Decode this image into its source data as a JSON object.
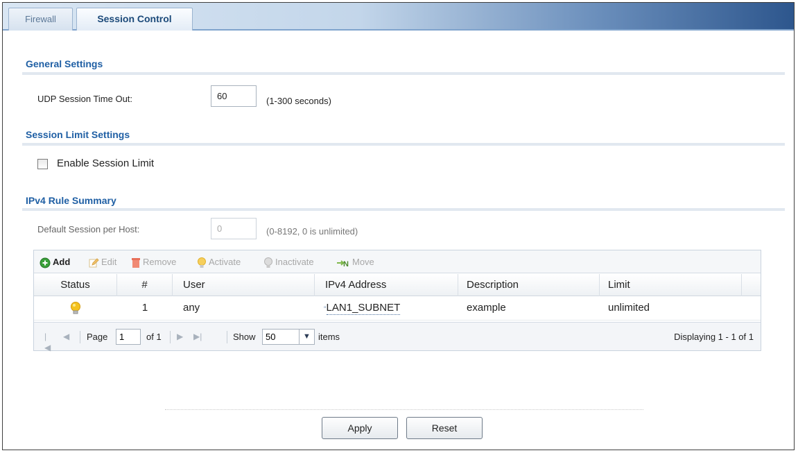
{
  "tabs": [
    {
      "label": "Firewall",
      "active": false
    },
    {
      "label": "Session Control",
      "active": true
    }
  ],
  "general": {
    "title": "General Settings",
    "udp_label": "UDP Session Time Out:",
    "udp_value": "60",
    "udp_hint": "(1-300 seconds)"
  },
  "session_limit": {
    "title": "Session Limit Settings",
    "enable_label": "Enable Session Limit",
    "enabled": false
  },
  "ipv4": {
    "title": "IPv4 Rule Summary",
    "default_label": "Default Session per Host:",
    "default_value": "0",
    "default_hint": "(0-8192, 0 is unlimited)"
  },
  "toolbar": {
    "add": "Add",
    "edit": "Edit",
    "remove": "Remove",
    "activate": "Activate",
    "inactivate": "Inactivate",
    "move": "Move"
  },
  "table": {
    "columns": [
      "Status",
      "#",
      "User",
      "IPv4 Address",
      "Description",
      "Limit"
    ],
    "rows": [
      {
        "status": "active",
        "num": "1",
        "user": "any",
        "ipv4": "LAN1_SUBNET",
        "description": "example",
        "limit": "unlimited"
      }
    ]
  },
  "pager": {
    "page_label": "Page",
    "page_value": "1",
    "of_label": "of 1",
    "show_label": "Show",
    "show_value": "50",
    "items_label": "items",
    "displaying": "Displaying 1 - 1 of 1"
  },
  "buttons": {
    "apply": "Apply",
    "reset": "Reset"
  },
  "colors": {
    "section_title": "#1f5fa4",
    "tab_bar_dark": "#2d568d",
    "bulb": "#f4c21f"
  }
}
